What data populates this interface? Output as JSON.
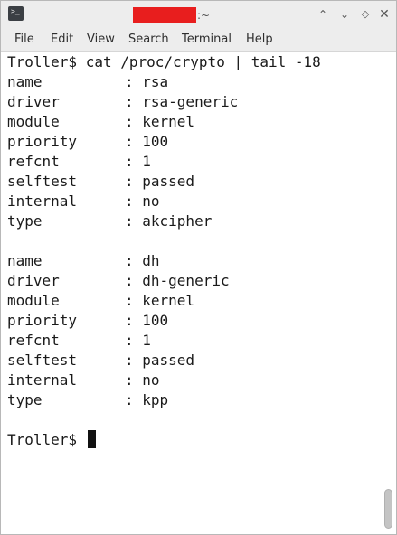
{
  "window": {
    "title_suffix": ":~",
    "app_icon_glyph": ">_",
    "controls": {
      "min_glyph": "⌃",
      "minimize_glyph": "⌄",
      "max_glyph": "◇",
      "close_glyph": "✕"
    }
  },
  "menu": {
    "items": [
      "File",
      "Edit",
      "View",
      "Search",
      "Terminal",
      "Help"
    ]
  },
  "terminal": {
    "command_line": "Troller$ cat /proc/crypto | tail -18",
    "blocks": [
      [
        {
          "key": "name",
          "value": ": rsa"
        },
        {
          "key": "driver",
          "value": ": rsa-generic"
        },
        {
          "key": "module",
          "value": ": kernel"
        },
        {
          "key": "priority",
          "value": ": 100"
        },
        {
          "key": "refcnt",
          "value": ": 1"
        },
        {
          "key": "selftest",
          "value": ": passed"
        },
        {
          "key": "internal",
          "value": ": no"
        },
        {
          "key": "type",
          "value": ": akcipher"
        }
      ],
      [
        {
          "key": "name",
          "value": ": dh"
        },
        {
          "key": "driver",
          "value": ": dh-generic"
        },
        {
          "key": "module",
          "value": ": kernel"
        },
        {
          "key": "priority",
          "value": ": 100"
        },
        {
          "key": "refcnt",
          "value": ": 1"
        },
        {
          "key": "selftest",
          "value": ": passed"
        },
        {
          "key": "internal",
          "value": ": no"
        },
        {
          "key": "type",
          "value": ": kpp"
        }
      ]
    ],
    "prompt": "Troller$ "
  }
}
